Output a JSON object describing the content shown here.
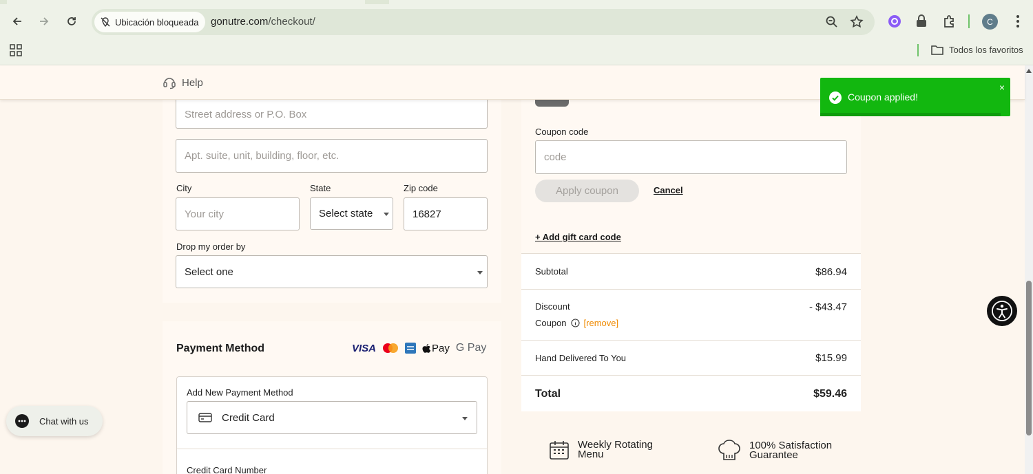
{
  "browser": {
    "site_chip": "Ubicación bloqueada",
    "url_domain": "gonutre.com",
    "url_path": "/checkout/",
    "bookmarks_folder": "Todos los favoritos",
    "profile_initial": "C"
  },
  "header": {
    "help_label": "Help"
  },
  "address": {
    "street_placeholder": "Street address or P.O. Box",
    "apt_placeholder": "Apt. suite, unit, building, floor, etc.",
    "city_label": "City",
    "city_placeholder": "Your city",
    "state_label": "State",
    "state_value": "Select state",
    "zip_label": "Zip code",
    "zip_value": "16827",
    "drop_label": "Drop my order by",
    "drop_value": "Select one"
  },
  "payment": {
    "title": "Payment Method",
    "logos": [
      "VISA",
      "Pay",
      "G Pay"
    ],
    "add_new_label": "Add New Payment Method",
    "method_value": "Credit Card",
    "card_number_label": "Credit Card Number"
  },
  "coupon": {
    "label": "Coupon code",
    "placeholder": "code",
    "apply_label": "Apply coupon",
    "cancel_label": "Cancel",
    "gift_card_label": "+ Add gift card code"
  },
  "summary": {
    "subtotal_label": "Subtotal",
    "subtotal_value": "$86.94",
    "discount_label": "Discount",
    "discount_value": "- $43.47",
    "coupon_label": "Coupon",
    "remove_label": "[remove]",
    "delivery_label": "Hand Delivered To You",
    "delivery_value": "$15.99",
    "total_label": "Total",
    "total_value": "$59.46"
  },
  "features": {
    "weekly_line1": "Weekly Rotating",
    "weekly_line2": "Menu",
    "satisfaction_line1": "100% Satisfaction",
    "satisfaction_line2": "Guarantee"
  },
  "toast": {
    "message": "Coupon applied!",
    "close": "×"
  },
  "chat": {
    "label": "Chat with us"
  },
  "colors": {
    "toast_green": "#12b70f",
    "remove_orange": "#f08a00",
    "page_bg": "#fdf6ee"
  }
}
